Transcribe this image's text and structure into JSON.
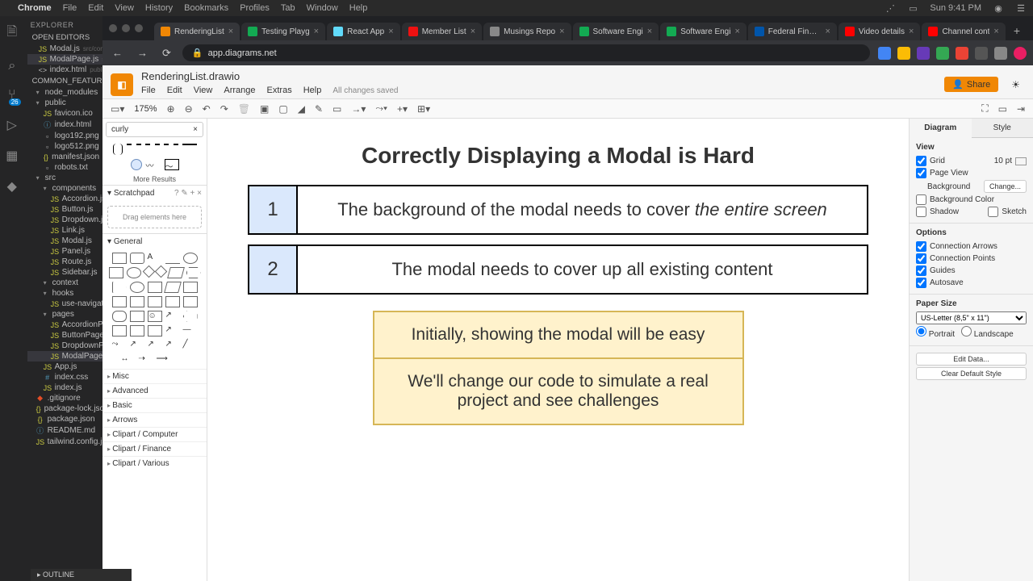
{
  "menubar": {
    "app": "Chrome",
    "items": [
      "File",
      "Edit",
      "View",
      "History",
      "Bookmarks",
      "Profiles",
      "Tab",
      "Window",
      "Help"
    ],
    "time": "Sun 9:41 PM"
  },
  "vscode": {
    "explorer": "EXPLORER",
    "open_editors": "OPEN EDITORS",
    "workspace": "COMMON_FEATURES",
    "outline": "OUTLINE",
    "editors": [
      {
        "icon": "JS",
        "name": "Modal.js",
        "path": "src/compone"
      },
      {
        "icon": "JS",
        "name": "ModalPage.js",
        "path": "src/pag",
        "sel": true
      },
      {
        "icon": "<>",
        "name": "index.html",
        "path": "public"
      }
    ],
    "tree": [
      {
        "t": "folder",
        "open": true,
        "n": "node_modules",
        "d": 1
      },
      {
        "t": "folder",
        "open": true,
        "n": "public",
        "d": 1
      },
      {
        "t": "file",
        "cls": "js",
        "n": "favicon.ico",
        "d": 2
      },
      {
        "t": "file",
        "cls": "md",
        "n": "index.html",
        "d": 2
      },
      {
        "t": "file",
        "cls": "",
        "n": "logo192.png",
        "d": 2
      },
      {
        "t": "file",
        "cls": "",
        "n": "logo512.png",
        "d": 2
      },
      {
        "t": "file",
        "cls": "json",
        "n": "manifest.json",
        "d": 2
      },
      {
        "t": "file",
        "cls": "",
        "n": "robots.txt",
        "d": 2
      },
      {
        "t": "folder",
        "open": true,
        "n": "src",
        "d": 1
      },
      {
        "t": "folder",
        "open": true,
        "n": "components",
        "d": 2
      },
      {
        "t": "file",
        "cls": "js",
        "n": "Accordion.js",
        "d": 3
      },
      {
        "t": "file",
        "cls": "js",
        "n": "Button.js",
        "d": 3
      },
      {
        "t": "file",
        "cls": "js",
        "n": "Dropdown.js",
        "d": 3
      },
      {
        "t": "file",
        "cls": "js",
        "n": "Link.js",
        "d": 3
      },
      {
        "t": "file",
        "cls": "js",
        "n": "Modal.js",
        "d": 3
      },
      {
        "t": "file",
        "cls": "js",
        "n": "Panel.js",
        "d": 3
      },
      {
        "t": "file",
        "cls": "js",
        "n": "Route.js",
        "d": 3
      },
      {
        "t": "file",
        "cls": "js",
        "n": "Sidebar.js",
        "d": 3
      },
      {
        "t": "folder",
        "open": true,
        "n": "context",
        "d": 2
      },
      {
        "t": "folder",
        "open": true,
        "n": "hooks",
        "d": 2
      },
      {
        "t": "file",
        "cls": "js",
        "n": "use-navigation.js",
        "d": 3
      },
      {
        "t": "folder",
        "open": true,
        "n": "pages",
        "d": 2
      },
      {
        "t": "file",
        "cls": "js",
        "n": "AccordionPage.js",
        "d": 3
      },
      {
        "t": "file",
        "cls": "js",
        "n": "ButtonPage.js",
        "d": 3
      },
      {
        "t": "file",
        "cls": "js",
        "n": "DropdownPage.js",
        "d": 3
      },
      {
        "t": "file",
        "cls": "js",
        "n": "ModalPage.js",
        "d": 3,
        "sel": true
      },
      {
        "t": "file",
        "cls": "js",
        "n": "App.js",
        "d": 2
      },
      {
        "t": "file",
        "cls": "css",
        "n": "index.css",
        "d": 2
      },
      {
        "t": "file",
        "cls": "js",
        "n": "index.js",
        "d": 2
      },
      {
        "t": "file",
        "cls": "git",
        "n": ".gitignore",
        "d": 1
      },
      {
        "t": "file",
        "cls": "json",
        "n": "package-lock.json",
        "d": 1
      },
      {
        "t": "file",
        "cls": "json",
        "n": "package.json",
        "d": 1
      },
      {
        "t": "file",
        "cls": "md",
        "n": "README.md",
        "d": 1
      },
      {
        "t": "file",
        "cls": "js",
        "n": "tailwind.config.js",
        "d": 1
      }
    ]
  },
  "chrome": {
    "tabs": [
      {
        "t": "RenderingList",
        "c": "#f08705",
        "active": true
      },
      {
        "t": "Testing Playg",
        "c": "#13aa52"
      },
      {
        "t": "React App",
        "c": "#61dafb"
      },
      {
        "t": "Member List",
        "c": "#e11"
      },
      {
        "t": "Musings Repo",
        "c": "#888"
      },
      {
        "t": "Software Engi",
        "c": "#13aa52"
      },
      {
        "t": "Software Engi",
        "c": "#13aa52"
      },
      {
        "t": "Federal Financ",
        "c": "#05a"
      },
      {
        "t": "Video details",
        "c": "#f00"
      },
      {
        "t": "Channel cont",
        "c": "#f00"
      }
    ],
    "url": "app.diagrams.net"
  },
  "drawio": {
    "filename": "RenderingList.drawio",
    "menu": [
      "File",
      "Edit",
      "View",
      "Arrange",
      "Extras",
      "Help"
    ],
    "saved": "All changes saved",
    "share": "Share",
    "zoom": "175%",
    "search_value": "curly",
    "more": "More Results",
    "scratchpad": "Scratchpad",
    "drag_hint": "Drag elements here",
    "general": "General",
    "cats": [
      "Misc",
      "Advanced",
      "Basic",
      "Arrows",
      "Clipart / Computer",
      "Clipart / Finance",
      "Clipart / Various"
    ],
    "fmt_tabs": [
      "Diagram",
      "Style"
    ],
    "view": "View",
    "grid": "Grid",
    "grid_val": "10 pt",
    "page_view": "Page View",
    "background": "Background",
    "change": "Change...",
    "bg_color": "Background Color",
    "shadow": "Shadow",
    "sketch": "Sketch",
    "options": "Options",
    "conn_arrows": "Connection Arrows",
    "conn_points": "Connection Points",
    "guides": "Guides",
    "autosave": "Autosave",
    "paper": "Paper Size",
    "paper_val": "US-Letter (8,5\" x 11\")",
    "portrait": "Portrait",
    "landscape": "Landscape",
    "edit_data": "Edit Data...",
    "clear_style": "Clear Default Style"
  },
  "diagram": {
    "title": "Correctly Displaying a Modal is Hard",
    "row1_num": "1",
    "row1_text": "The background of the modal needs to cover ",
    "row1_em": "the entire screen",
    "row2_num": "2",
    "row2_text": "The modal needs to cover up all existing content",
    "y1": "Initially, showing the modal will be easy",
    "y2": "We'll change our code to simulate a real project and see challenges"
  }
}
